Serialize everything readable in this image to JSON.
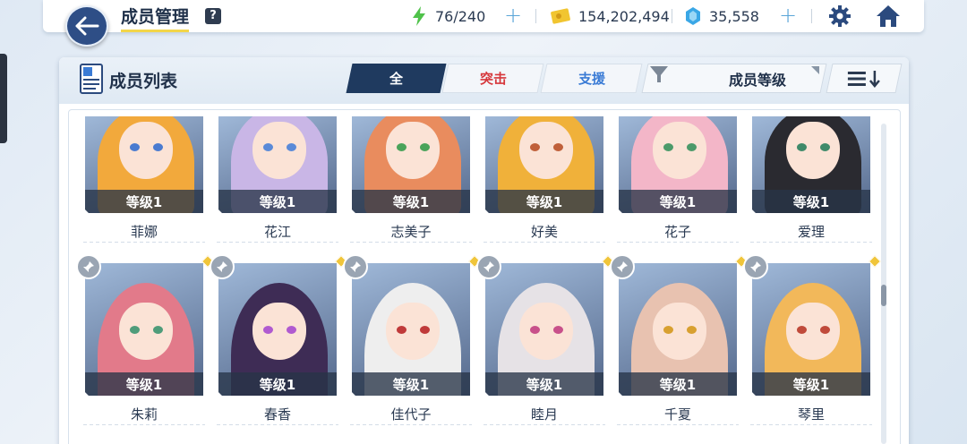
{
  "header": {
    "title": "成员管理",
    "help": "?",
    "stamina": "76/240",
    "credits": "154,202,494",
    "gems": "35,558"
  },
  "panel": {
    "title": "成员列表",
    "tabs": [
      {
        "label": "全"
      },
      {
        "label": "突击"
      },
      {
        "label": "支援"
      }
    ],
    "sort_label": "成员等级"
  },
  "members": [
    {
      "name": "菲娜",
      "level": "等级1",
      "hair": "#f2a93c",
      "eye": "#4a7bd0"
    },
    {
      "name": "花江",
      "level": "等级1",
      "hair": "#c9b6e6",
      "eye": "#5a8ad8"
    },
    {
      "name": "志美子",
      "level": "等级1",
      "hair": "#e98c5e",
      "eye": "#4aa35a"
    },
    {
      "name": "好美",
      "level": "等级1",
      "hair": "#f0b13a",
      "eye": "#c0603a"
    },
    {
      "name": "花子",
      "level": "等级1",
      "hair": "#f3b6c8",
      "eye": "#4c9a6a"
    },
    {
      "name": "爱理",
      "level": "等级1",
      "hair": "#2a2a30",
      "eye": "#3f8a6a"
    },
    {
      "name": "朱莉",
      "level": "等级1",
      "hair": "#e27a8a",
      "eye": "#4f9c7a"
    },
    {
      "name": "春香",
      "level": "等级1",
      "hair": "#3e2c55",
      "eye": "#b05ad0"
    },
    {
      "name": "佳代子",
      "level": "等级1",
      "hair": "#eeeeee",
      "eye": "#c03a3a"
    },
    {
      "name": "睦月",
      "level": "等级1",
      "hair": "#e6e2e6",
      "eye": "#c8508a"
    },
    {
      "name": "千夏",
      "level": "等级1",
      "hair": "#e8c2b0",
      "eye": "#d8a030"
    },
    {
      "name": "琴里",
      "level": "等级1",
      "hair": "#f2b85a",
      "eye": "#c04a3a"
    }
  ],
  "colors": {
    "accent": "#1f3a5f",
    "strike": "#d6383c",
    "support": "#3a7bd5",
    "back_button": "#2e4e86"
  }
}
